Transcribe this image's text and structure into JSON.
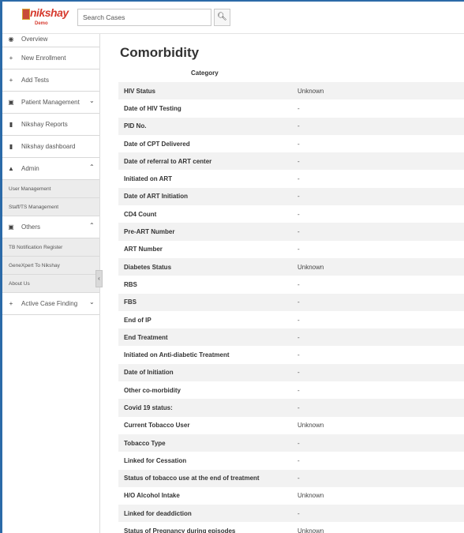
{
  "header": {
    "logo_text": "nikshay",
    "logo_sub": "Demo",
    "search_value": "Search Cases",
    "search_icon": "search-icon"
  },
  "sidebar": {
    "items": [
      {
        "label": "Overview",
        "icon": "dashboard-icon"
      },
      {
        "label": "New Enrollment",
        "icon": "plus-icon"
      },
      {
        "label": "Add Tests",
        "icon": "plus-icon"
      },
      {
        "label": "Patient Management",
        "icon": "briefcase-icon"
      },
      {
        "label": "Nikshay Reports",
        "icon": "file-icon"
      },
      {
        "label": "Nikshay dashboard",
        "icon": "file-icon"
      },
      {
        "label": "Admin",
        "icon": "user-icon"
      },
      {
        "label": "Others",
        "icon": "briefcase-icon"
      },
      {
        "label": "Active Case Finding",
        "icon": "plus-icon"
      }
    ],
    "admin_sub": [
      "User Management",
      "Staff/TS Management"
    ],
    "others_sub": [
      "TB Notification Register",
      "GeneXpert To Nikshay",
      "About Us"
    ]
  },
  "main": {
    "title": "Comorbidity",
    "column_header": "Category",
    "rows": [
      {
        "label": "HIV Status",
        "value": "Unknown"
      },
      {
        "label": "Date of HIV Testing",
        "value": "-"
      },
      {
        "label": "PID No.",
        "value": "-"
      },
      {
        "label": "Date of CPT Delivered",
        "value": "-"
      },
      {
        "label": "Date of referral to ART center",
        "value": "-"
      },
      {
        "label": "Initiated on ART",
        "value": "-"
      },
      {
        "label": "Date of ART Initiation",
        "value": "-"
      },
      {
        "label": "CD4 Count",
        "value": "-"
      },
      {
        "label": "Pre-ART Number",
        "value": "-"
      },
      {
        "label": "ART Number",
        "value": "-"
      },
      {
        "label": "Diabetes Status",
        "value": "Unknown"
      },
      {
        "label": "RBS",
        "value": "-"
      },
      {
        "label": "FBS",
        "value": "-"
      },
      {
        "label": "End of IP",
        "value": "-"
      },
      {
        "label": "End Treatment",
        "value": "-"
      },
      {
        "label": "Initiated on Anti-diabetic Treatment",
        "value": "-"
      },
      {
        "label": "Date of Initiation",
        "value": "-"
      },
      {
        "label": "Other co-morbidity",
        "value": "-"
      },
      {
        "label": "Covid 19 status:",
        "value": "-"
      },
      {
        "label": "Current Tobacco User",
        "value": "Unknown"
      },
      {
        "label": "Tobacco Type",
        "value": "-"
      },
      {
        "label": "Linked for Cessation",
        "value": "-"
      },
      {
        "label": "Status of tobacco use at the end of treatment",
        "value": "-"
      },
      {
        "label": "H/O Alcohol Intake",
        "value": "Unknown"
      },
      {
        "label": "Linked for deaddiction",
        "value": "-"
      },
      {
        "label": "Status of Pregnancy during episodes",
        "value": "Unknown"
      }
    ]
  },
  "colors": {
    "accent": "#2b6aa8",
    "logo": "#d63a2e",
    "row_alt": "#f2f2f2"
  }
}
